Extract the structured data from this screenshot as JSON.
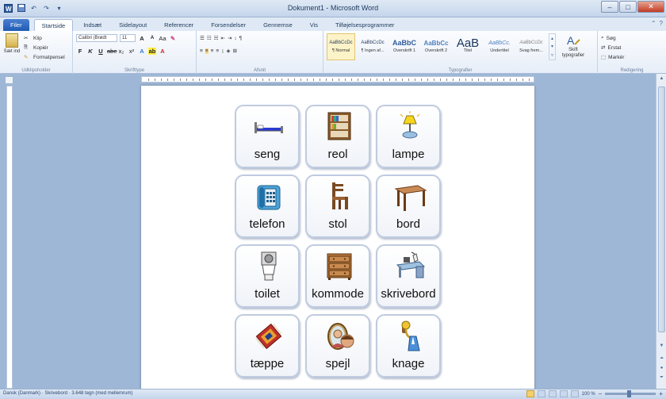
{
  "window": {
    "title": "Dokument1 - Microsoft Word",
    "controls": {
      "minimize": "–",
      "maximize": "□",
      "close": "✕"
    }
  },
  "quick_access": {
    "items": [
      "save-icon",
      "undo-icon",
      "redo-icon",
      "customize-icon"
    ]
  },
  "tabs": [
    {
      "label": "Filer",
      "active": false
    },
    {
      "label": "Startside",
      "active": true
    },
    {
      "label": "Indsæt",
      "active": false
    },
    {
      "label": "Sidelayout",
      "active": false
    },
    {
      "label": "Referencer",
      "active": false
    },
    {
      "label": "Forsendelser",
      "active": false
    },
    {
      "label": "Gennemse",
      "active": false
    },
    {
      "label": "Vis",
      "active": false
    },
    {
      "label": "Tilføjelsesprogrammer",
      "active": false
    }
  ],
  "ribbon": {
    "clipboard": {
      "label": "Udklipsholder",
      "paste": "Sæt ind",
      "cut": "Klip",
      "copy": "Kopiér",
      "format_painter": "Formatpensel"
    },
    "font": {
      "label": "Skrifttype",
      "font_name": "Calibri (Brødt",
      "font_size": "11"
    },
    "paragraph": {
      "label": "Afsnit"
    },
    "styles": {
      "label": "Typografier",
      "items": [
        {
          "sample": "AaBbCcDc",
          "name": "¶ Normal",
          "selected": true
        },
        {
          "sample": "AaBbCcDc",
          "name": "¶ Ingen af...",
          "selected": false
        },
        {
          "sample": "AaBbC",
          "name": "Overskrift 1",
          "selected": false
        },
        {
          "sample": "AaBbCc",
          "name": "Overskrift 2",
          "selected": false
        },
        {
          "sample": "AaB",
          "name": "Titel",
          "selected": false
        },
        {
          "sample": "AaBbCc.",
          "name": "Undertitel",
          "selected": false
        },
        {
          "sample": "AaBbCcDc",
          "name": "Svag frem...",
          "selected": false
        }
      ],
      "change_styles": "Skift typografier"
    },
    "editing": {
      "label": "Redigering",
      "find": "Søg",
      "replace": "Erstat",
      "select": "Markér"
    }
  },
  "document": {
    "cards": [
      {
        "label": "seng",
        "icon": "bed-icon"
      },
      {
        "label": "reol",
        "icon": "bookshelf-icon"
      },
      {
        "label": "lampe",
        "icon": "lamp-icon"
      },
      {
        "label": "telefon",
        "icon": "telephone-icon"
      },
      {
        "label": "stol",
        "icon": "chair-icon"
      },
      {
        "label": "bord",
        "icon": "table-icon"
      },
      {
        "label": "toilet",
        "icon": "toilet-icon"
      },
      {
        "label": "kommode",
        "icon": "dresser-icon"
      },
      {
        "label": "skrivebord",
        "icon": "desk-icon"
      },
      {
        "label": "tæppe",
        "icon": "rug-icon"
      },
      {
        "label": "spejl",
        "icon": "mirror-icon"
      },
      {
        "label": "knage",
        "icon": "coat-hook-icon"
      }
    ]
  },
  "status": {
    "text": "Dansk (Danmark) · Skrivebord · 3.648 tegn (med mellemrum)",
    "zoom": "100 %"
  },
  "colors": {
    "ribbon_bg": "#e7eef8",
    "doc_bg": "#9fb7d6",
    "file_tab": "#1f5bb5",
    "card_border": "#bfcbe0"
  }
}
